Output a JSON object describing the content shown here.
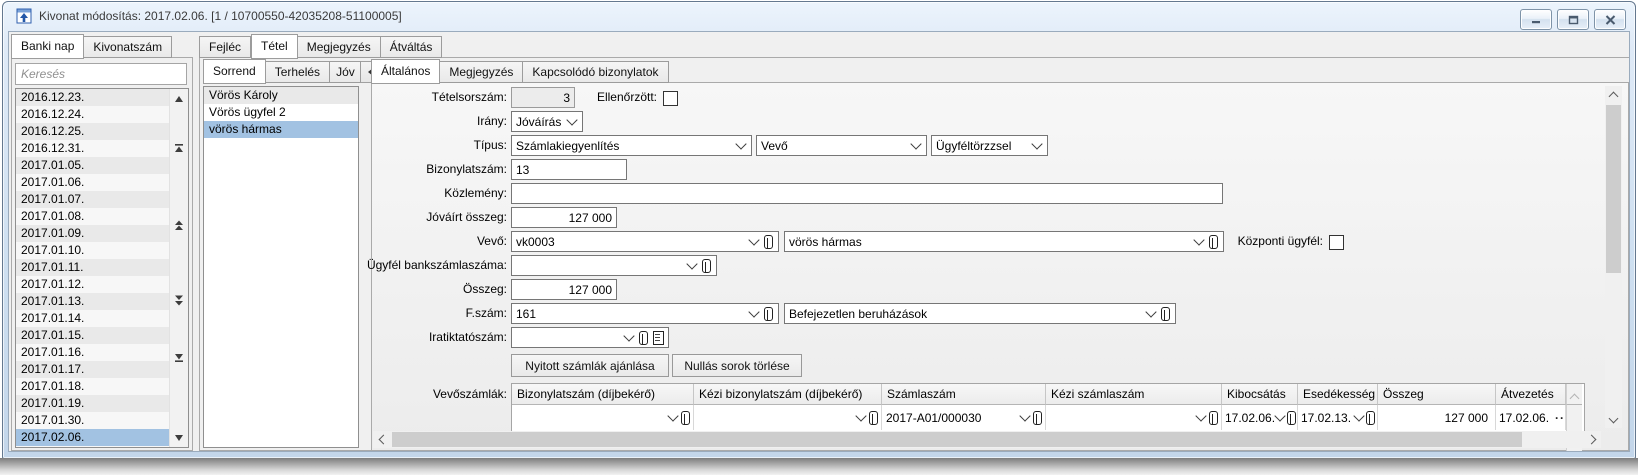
{
  "window": {
    "title": "Kivonat módosítás: 2017.02.06. [1 / 10700550-42035208-51100005]"
  },
  "left_panel": {
    "tabs": [
      {
        "label": "Banki nap",
        "active": true
      },
      {
        "label": "Kivonatszám",
        "active": false
      }
    ],
    "search_placeholder": "Keresés",
    "dates": [
      "2016.12.23.",
      "2016.12.24.",
      "2016.12.25.",
      "2016.12.31.",
      "2017.01.05.",
      "2017.01.06.",
      "2017.01.07.",
      "2017.01.08.",
      "2017.01.09.",
      "2017.01.10.",
      "2017.01.11.",
      "2017.01.12.",
      "2017.01.13.",
      "2017.01.14.",
      "2017.01.15.",
      "2017.01.16.",
      "2017.01.17.",
      "2017.01.18.",
      "2017.01.19.",
      "2017.01.30.",
      "2017.02.06."
    ],
    "selected_date": "2017.02.06."
  },
  "main_tabs": [
    {
      "label": "Fejléc",
      "active": false
    },
    {
      "label": "Tétel",
      "active": true
    },
    {
      "label": "Megjegyzés",
      "active": false
    },
    {
      "label": "Átváltás",
      "active": false
    }
  ],
  "sorrend_panel": {
    "tabs": [
      {
        "label": "Sorrend",
        "active": true
      },
      {
        "label": "Terhelés",
        "active": false
      },
      {
        "label": "Jóv",
        "active": false
      }
    ],
    "items": [
      "Vörös Károly",
      "Vörös ügyfel 2",
      "vörös hármas"
    ],
    "selected_item": "vörös hármas"
  },
  "detail_tabs": [
    {
      "label": "Általános",
      "active": true
    },
    {
      "label": "Megjegyzés",
      "active": false
    },
    {
      "label": "Kapcsolódó bizonylatok",
      "active": false
    }
  ],
  "form": {
    "tetelsorszam_label": "Tételsorszám:",
    "tetelsorszam": "3",
    "ellenorzott_label": "Ellenőrzött:",
    "ellenorzott_checked": false,
    "irany_label": "Irány:",
    "irany": "Jóváírás",
    "tipus_label": "Típus:",
    "tipus1": "Számlakiegyenlítés",
    "tipus2": "Vevő",
    "tipus3": "Ügyféltörzzsel",
    "bizonylatszam_label": "Bizonylatszám:",
    "bizonylatszam": "13",
    "kozlemeny_label": "Közlemény:",
    "kozlemeny": "",
    "jovairt_osszeg_label": "Jóváírt összeg:",
    "jovairt_osszeg": "127 000",
    "vevo_label": "Vevő:",
    "vevo_kod": "vk0003",
    "vevo_nev": "vörös hármas",
    "kozponti_ugyfel_label": "Központi ügyfél:",
    "kozponti_ugyfel_checked": false,
    "bankszamla_label": "Ügyfél bankszámlaszáma:",
    "bankszamla": "",
    "osszeg_label": "Összeg:",
    "osszeg": "127 000",
    "fszam_label": "F.szám:",
    "fszam_kod": "161",
    "fszam_nev": "Befejezetlen beruházások",
    "iratiktatoszam_label": "Iratiktatószám:",
    "iratiktatoszam": "",
    "ajanlas_button": "Nyitott számlák ajánlása",
    "nullas_button": "Nullás sorok törlése",
    "vevoszamlak_label": "Vevőszámlák:"
  },
  "invoice_table": {
    "columns": [
      "Bizonylatszám (díjbekérő)",
      "Kézi bizonylatszám (díjbekérő)",
      "Számlaszám",
      "Kézi számlaszám",
      "Kibocsátás",
      "Esedékesség",
      "Összeg",
      "Átvezetés"
    ],
    "row": {
      "bizonylatszam": "",
      "kezi_bizonylatszam": "",
      "szamlaszam": "2017-A01/000030",
      "kezi_szamlaszam": "",
      "kibocsatas": "17.02.06.",
      "esedekesseg": "17.02.13.",
      "osszeg": "127 000",
      "atvezetes": "17.02.06.",
      "more": "···"
    }
  }
}
